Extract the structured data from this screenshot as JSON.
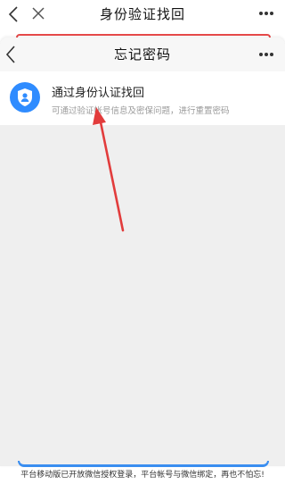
{
  "background_page": {
    "title": "身份验证找回",
    "icons": {
      "back": "chevron-left-icon",
      "close": "close-icon",
      "more": "more-dots-icon"
    }
  },
  "sheet": {
    "title": "忘记密码",
    "icons": {
      "back": "chevron-left-icon",
      "more": "more-dots-icon"
    },
    "options": [
      {
        "title": "通过身份认证找回",
        "description": "可通过验证帐号信息及密保问题，进行重置密码",
        "icon": "shield-user-icon"
      }
    ]
  },
  "footer_note": "平台移动版已开放微信授权登录，平台帐号与微信绑定，再也不怕忘!",
  "colors": {
    "accent_blue": "#2f8cff",
    "annotation_red": "#e23c3c",
    "sheet_background": "#efefef"
  }
}
